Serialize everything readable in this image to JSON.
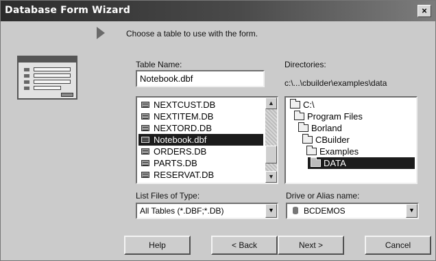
{
  "window": {
    "title": "Database Form Wizard",
    "close_glyph": "×"
  },
  "instruction": "Choose a table to use with the form.",
  "table_name": {
    "label": "Table Name:",
    "value": "Notebook.dbf",
    "items": [
      "NEXTCUST.DB",
      "NEXTITEM.DB",
      "NEXTORD.DB",
      "Notebook.dbf",
      "ORDERS.DB",
      "PARTS.DB",
      "RESERVAT.DB"
    ],
    "selected_index": 3
  },
  "directories": {
    "label": "Directories:",
    "path": "c:\\...\\cbuilder\\examples\\data",
    "tree": [
      "C:\\",
      "Program Files",
      "Borland",
      "CBuilder",
      "Examples",
      "DATA"
    ],
    "selected_index": 5
  },
  "file_type": {
    "label": "List Files of Type:",
    "value": "All Tables (*.DBF;*.DB)"
  },
  "drive": {
    "label": "Drive or Alias name:",
    "value": "BCDEMOS"
  },
  "buttons": {
    "help": "Help",
    "back": "< Back",
    "next": "Next >",
    "cancel": "Cancel"
  },
  "icons": {
    "table": "table-file-icon",
    "folder": "folder-icon",
    "alias": "database-cylinder-icon",
    "step": "step-arrow-icon",
    "wizard": "form-illustration-icon"
  }
}
